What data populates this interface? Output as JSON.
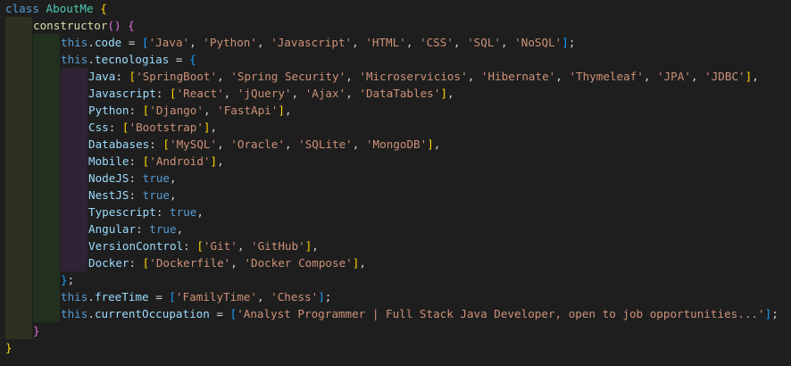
{
  "code": {
    "class_keyword": "class",
    "class_name": "AboutMe",
    "constructor_name": "constructor",
    "this_kw": "this",
    "code_prop": "code",
    "code_values": [
      "'Java'",
      "'Python'",
      "'Javascript'",
      "'HTML'",
      "'CSS'",
      "'SQL'",
      "'NoSQL'"
    ],
    "tec_prop": "tecnologias",
    "tecnologias": [
      {
        "key": "Java",
        "values": [
          "'SpringBoot'",
          "'Spring Security'",
          "'Microservicios'",
          "'Hibernate'",
          "'Thymeleaf'",
          "'JPA'",
          "'JDBC'"
        ]
      },
      {
        "key": "Javascript",
        "values": [
          "'React'",
          "'jQuery'",
          "'Ajax'",
          "'DataTables'"
        ]
      },
      {
        "key": "Python",
        "values": [
          "'Django'",
          "'FastApi'"
        ]
      },
      {
        "key": "Css",
        "values": [
          "'Bootstrap'"
        ]
      },
      {
        "key": "Databases",
        "values": [
          "'MySQL'",
          "'Oracle'",
          "'SQLite'",
          "'MongoDB'"
        ]
      },
      {
        "key": "Mobile",
        "values": [
          "'Android'"
        ]
      },
      {
        "key": "NodeJS",
        "bool": "true"
      },
      {
        "key": "NestJS",
        "bool": "true"
      },
      {
        "key": "Typescript",
        "bool": "true"
      },
      {
        "key": "Angular",
        "bool": "true"
      },
      {
        "key": "VersionControl",
        "values": [
          "'Git'",
          "'GitHub'"
        ]
      },
      {
        "key": "Docker",
        "values": [
          "'Dockerfile'",
          "'Docker Compose'"
        ]
      }
    ],
    "free_prop": "freeTime",
    "free_values": [
      "'FamilyTime'",
      "'Chess'"
    ],
    "occ_prop": "currentOccupation",
    "occ_values": [
      "'Analyst Programmer | Full Stack Java Developer, open to job opportunities...'"
    ]
  },
  "colors": {
    "background": "#1e1e1e",
    "keyword": "#569cd6",
    "class_name": "#4ec9b0",
    "function": "#dcdcaa",
    "property": "#9cdcfe",
    "string": "#ce9178",
    "bracket_1": "#ffd700",
    "bracket_2": "#da70d6",
    "bracket_3": "#179fff"
  }
}
